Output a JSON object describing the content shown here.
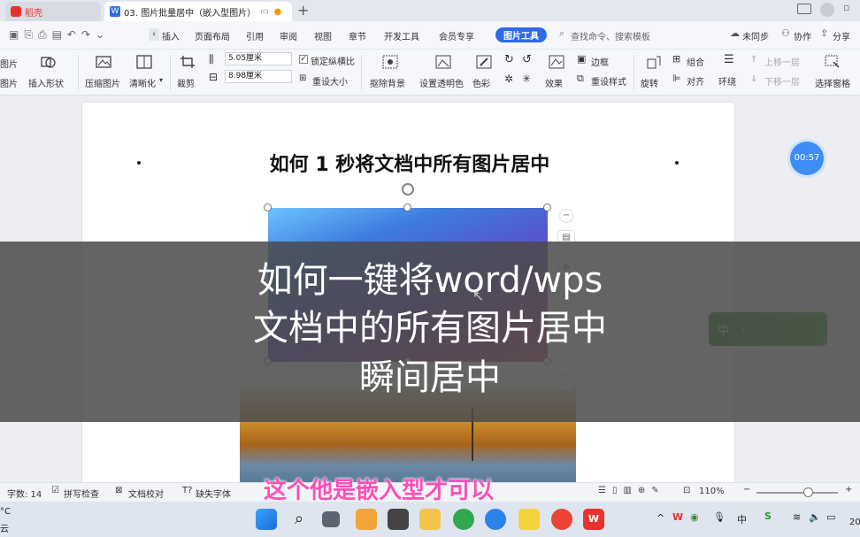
{
  "tabs": [
    {
      "label": "稻壳",
      "icon": "docer-icon"
    },
    {
      "label": "03. 图片批量居中（嵌入型图片）",
      "icon": "wps-doc-icon"
    }
  ],
  "menu": [
    "插入",
    "页面布局",
    "引用",
    "审阅",
    "视图",
    "章节",
    "开发工具",
    "会员专享",
    "图片工具"
  ],
  "active_menu": "图片工具",
  "search_placeholder": "查找命令、搜索模板",
  "right_actions": {
    "sync": "未同步",
    "collab": "协作",
    "share": "分享"
  },
  "ribbon": {
    "edit_image": "图片",
    "insert_image": "图片",
    "insert_shape": "插入形状",
    "compress": "压缩图片",
    "clarity": "清晰化",
    "crop": "裁剪",
    "width": "5.05厘米",
    "height": "8.98厘米",
    "lock_ratio": "锁定纵横比",
    "reset_size": "重设大小",
    "remove_bg": "抠除背景",
    "transparent": "设置透明色",
    "color": "色彩",
    "effects": "效果",
    "border": "边框",
    "reset_style": "重设样式",
    "rotate": "旋转",
    "group": "组合",
    "align": "对齐",
    "wrap": "环绕",
    "up_layer": "上移一层",
    "down_layer": "下移一层",
    "select_pane": "选择窗格"
  },
  "document": {
    "title": "如何 1 秒将文档中所有图片居中"
  },
  "overlay": {
    "line1": "如何一键将word/wps",
    "line2": "文档中的所有图片居中",
    "line3": "瞬间居中"
  },
  "subtitle": "这个他是嵌入型才可以",
  "timer": "00:57",
  "ime_badge": "中",
  "status": {
    "word_count": "字数: 14",
    "spell": "拼写检查",
    "proof": "文档校对",
    "missing_font": "缺失字体",
    "zoom": "110%"
  },
  "taskbar": {
    "weather_temp": "°C",
    "weather_text": "云",
    "ime": "中",
    "clock": "20"
  },
  "colors": {
    "accent": "#2f6be6",
    "wps_red": "#e8322e",
    "overlay": "#4b4b4b",
    "subtitle": "#ff4fb8",
    "timer": "#3d8df5"
  }
}
